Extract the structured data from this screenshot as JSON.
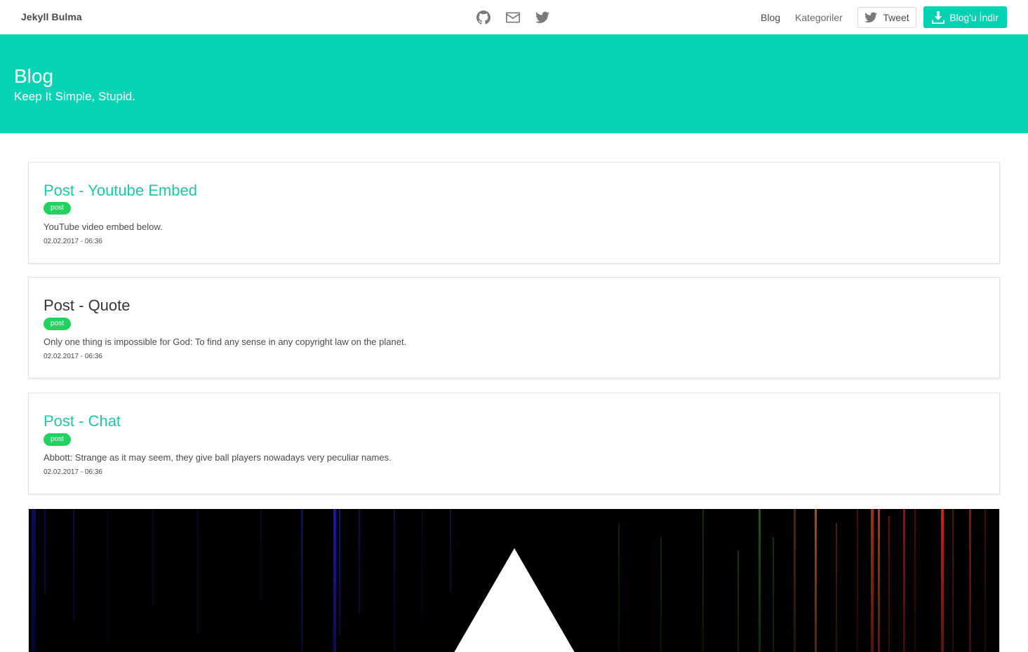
{
  "navbar": {
    "brand": "Jekyll Bulma",
    "icons": [
      "github-icon",
      "envelope-icon",
      "twitter-icon"
    ],
    "links": [
      "Blog",
      "Kategoriler"
    ],
    "tweet_label": "Tweet",
    "download_label": "Blog'u İndir"
  },
  "hero": {
    "title": "Blog",
    "subtitle": "Keep It Simple, Stupid."
  },
  "posts": [
    {
      "title": "Post - Youtube Embed",
      "tag": "post",
      "excerpt": "YouTube video embed below.",
      "date": "02.02.2017 - 06:36"
    },
    {
      "title": "Post - Quote",
      "tag": "post",
      "excerpt": "Only one thing is impossible for God: To find any sense in any copyright law on the planet.",
      "date": "02.02.2017 - 06:36"
    },
    {
      "title": "Post - Chat",
      "tag": "post",
      "excerpt": "Abbott: Strange as it may seem, they give ball players nowadays very peculiar names.",
      "date": "02.02.2017 - 06:36"
    }
  ],
  "colors": {
    "primary": "#00d1b2",
    "hero": "#05d3b3",
    "link": "#1fc8a5",
    "tag": "#23d160"
  }
}
